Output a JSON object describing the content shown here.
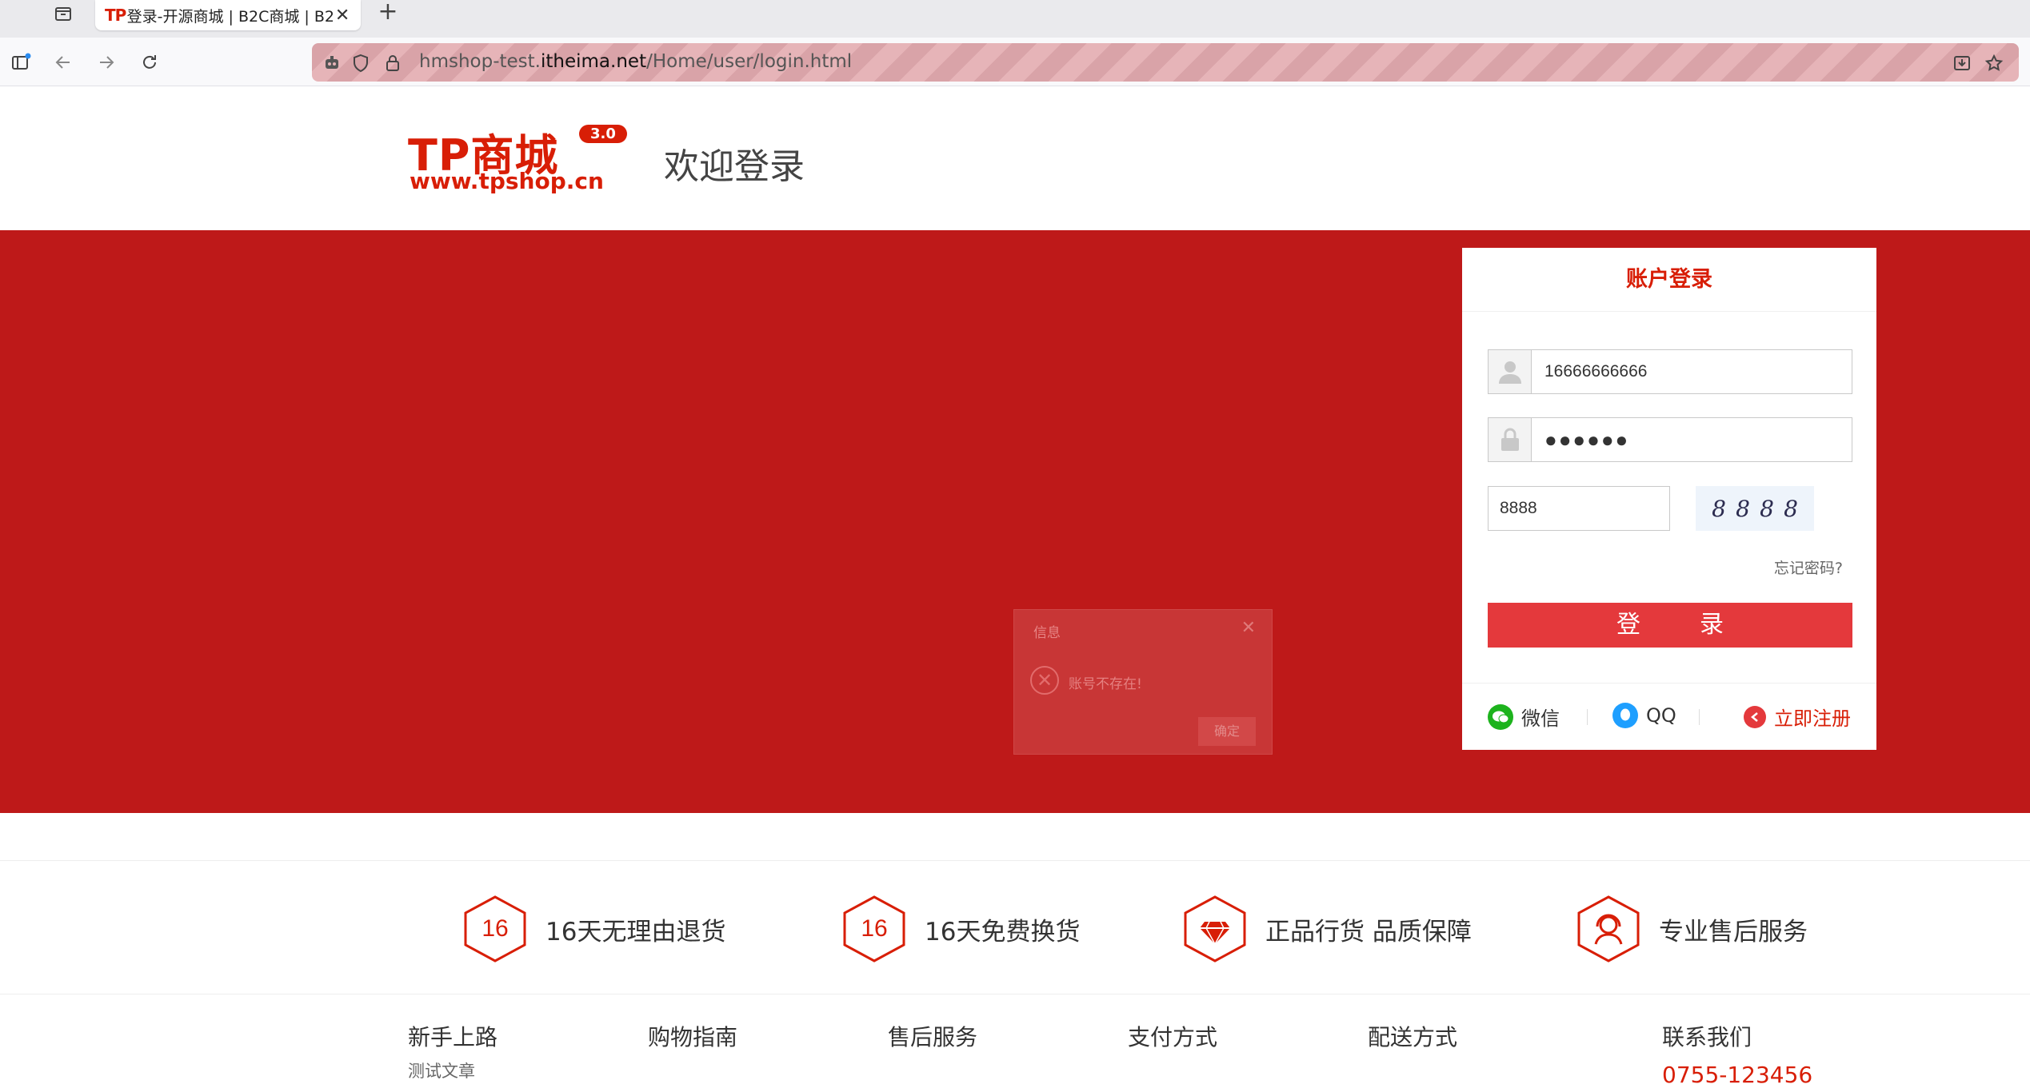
{
  "browser": {
    "tab_title": "登录-开源商城 | B2C商城 | B2B",
    "tab_favicon": "TP",
    "url_host_prefix": "hmshop-test.",
    "url_host_main": "itheima.net",
    "url_path": "/Home/user/login.html"
  },
  "header": {
    "logo_text": "TP商城",
    "logo_version": "3.0",
    "logo_url": "www.tpshop.cn",
    "welcome": "欢迎登录"
  },
  "login": {
    "title": "账户登录",
    "username": "16666666666",
    "password": "●●●●●●",
    "captcha_value": "8888",
    "captcha_chars": [
      "8",
      "8",
      "8",
      "8"
    ],
    "forgot": "忘记密码?",
    "submit": "登　录",
    "wechat": "微信",
    "qq": "QQ",
    "register": "立即注册"
  },
  "dialog": {
    "title": "信息",
    "message": "账号不存在!",
    "ok": "确定"
  },
  "services": [
    {
      "num": "16",
      "label": "16天无理由退货"
    },
    {
      "num": "16",
      "label": "16天免费换货"
    },
    {
      "num": "",
      "label": "正品行货 品质保障"
    },
    {
      "num": "",
      "label": "专业售后服务"
    }
  ],
  "footer": {
    "columns": [
      "新手上路",
      "购物指南",
      "售后服务",
      "支付方式",
      "配送方式",
      "联系我们"
    ],
    "sub_item": "测试文章",
    "phone": "0755-123456"
  },
  "colors": {
    "brand": "#d81e06",
    "banner": "#be1919",
    "button": "#e4393c"
  }
}
